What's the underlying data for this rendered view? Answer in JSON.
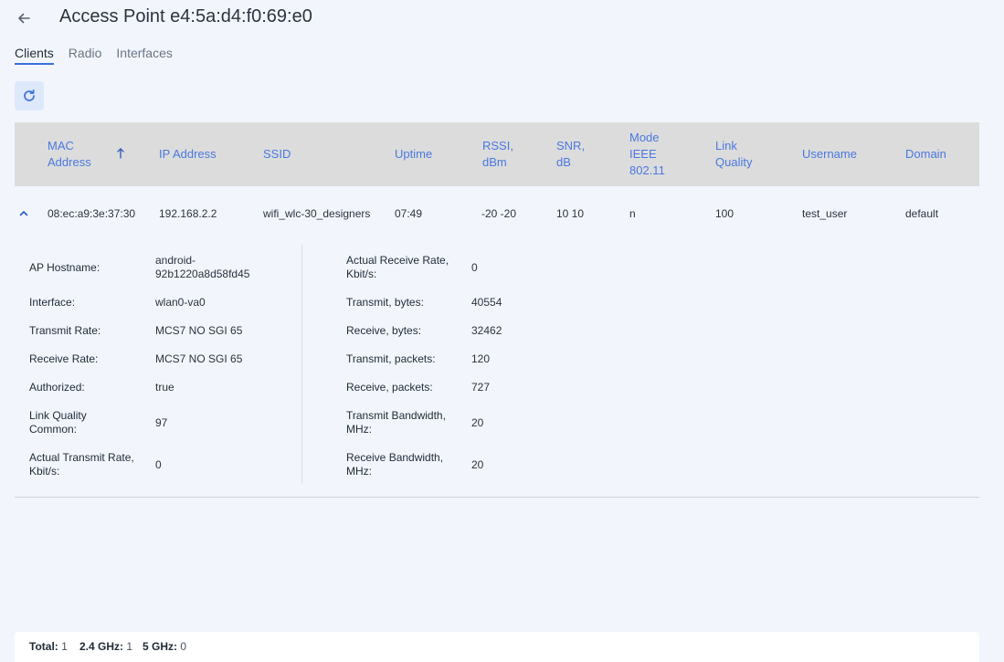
{
  "header": {
    "title": "Access Point e4:5a:d4:f0:69:e0"
  },
  "tabs": [
    {
      "label": "Clients"
    },
    {
      "label": "Radio"
    },
    {
      "label": "Interfaces"
    }
  ],
  "table": {
    "columns": [
      {
        "label": "MAC Address"
      },
      {
        "label": "IP Address"
      },
      {
        "label": "SSID"
      },
      {
        "label": "Uptime"
      },
      {
        "label": "RSSI, dBm"
      },
      {
        "label": "SNR, dB"
      },
      {
        "label": "Mode IEEE 802.11"
      },
      {
        "label": "Link Quality"
      },
      {
        "label": "Username"
      },
      {
        "label": "Domain"
      }
    ],
    "rows": [
      {
        "mac": "08:ec:a9:3e:37:30",
        "ip": "192.168.2.2",
        "ssid": "wifi_wlc-30_designers",
        "uptime": "07:49",
        "rssi": "-20 -20",
        "snr": "10 10",
        "mode": "n",
        "link_quality": "100",
        "username": "test_user",
        "domain": "default"
      }
    ]
  },
  "details": {
    "left": [
      {
        "label": "AP Hostname:",
        "value": "android-92b1220a8d58fd45"
      },
      {
        "label": "Interface:",
        "value": "wlan0-va0"
      },
      {
        "label": "Transmit Rate:",
        "value": "MCS7 NO SGI 65"
      },
      {
        "label": "Receive Rate:",
        "value": "MCS7 NO SGI 65"
      },
      {
        "label": "Authorized:",
        "value": "true"
      },
      {
        "label": "Link Quality Common:",
        "value": "97"
      },
      {
        "label": "Actual Transmit Rate, Kbit/s:",
        "value": "0"
      }
    ],
    "right": [
      {
        "label": "Actual Receive Rate, Kbit/s:",
        "value": "0"
      },
      {
        "label": "Transmit, bytes:",
        "value": "40554"
      },
      {
        "label": "Receive, bytes:",
        "value": "32462"
      },
      {
        "label": "Transmit, packets:",
        "value": "120"
      },
      {
        "label": "Receive, packets:",
        "value": "727"
      },
      {
        "label": "Transmit Bandwidth, MHz:",
        "value": "20"
      },
      {
        "label": "Receive Bandwidth, MHz:",
        "value": "20"
      }
    ]
  },
  "footer": {
    "total_label": "Total:",
    "total_value": "1",
    "g24_label": "2.4 GHz:",
    "g24_value": "1",
    "g5_label": "5 GHz:",
    "g5_value": "0"
  },
  "icons": {
    "back": "arrow-left-icon",
    "refresh": "refresh-icon",
    "sort": "arrow-up-icon",
    "expand": "chevron-up-icon"
  },
  "colors": {
    "accent": "#4a78e0",
    "background": "#f2f6fc",
    "table_header": "#dcdcdc"
  }
}
